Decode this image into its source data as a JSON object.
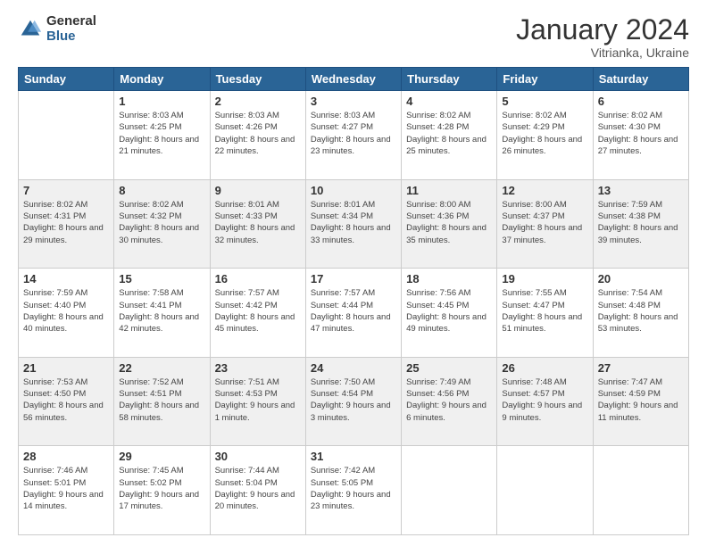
{
  "header": {
    "logo_general": "General",
    "logo_blue": "Blue",
    "title": "January 2024",
    "location": "Vitrianka, Ukraine"
  },
  "weekdays": [
    "Sunday",
    "Monday",
    "Tuesday",
    "Wednesday",
    "Thursday",
    "Friday",
    "Saturday"
  ],
  "weeks": [
    [
      {
        "day": "",
        "sunrise": "",
        "sunset": "",
        "daylight": ""
      },
      {
        "day": "1",
        "sunrise": "Sunrise: 8:03 AM",
        "sunset": "Sunset: 4:25 PM",
        "daylight": "Daylight: 8 hours and 21 minutes."
      },
      {
        "day": "2",
        "sunrise": "Sunrise: 8:03 AM",
        "sunset": "Sunset: 4:26 PM",
        "daylight": "Daylight: 8 hours and 22 minutes."
      },
      {
        "day": "3",
        "sunrise": "Sunrise: 8:03 AM",
        "sunset": "Sunset: 4:27 PM",
        "daylight": "Daylight: 8 hours and 23 minutes."
      },
      {
        "day": "4",
        "sunrise": "Sunrise: 8:02 AM",
        "sunset": "Sunset: 4:28 PM",
        "daylight": "Daylight: 8 hours and 25 minutes."
      },
      {
        "day": "5",
        "sunrise": "Sunrise: 8:02 AM",
        "sunset": "Sunset: 4:29 PM",
        "daylight": "Daylight: 8 hours and 26 minutes."
      },
      {
        "day": "6",
        "sunrise": "Sunrise: 8:02 AM",
        "sunset": "Sunset: 4:30 PM",
        "daylight": "Daylight: 8 hours and 27 minutes."
      }
    ],
    [
      {
        "day": "7",
        "sunrise": "Sunrise: 8:02 AM",
        "sunset": "Sunset: 4:31 PM",
        "daylight": "Daylight: 8 hours and 29 minutes."
      },
      {
        "day": "8",
        "sunrise": "Sunrise: 8:02 AM",
        "sunset": "Sunset: 4:32 PM",
        "daylight": "Daylight: 8 hours and 30 minutes."
      },
      {
        "day": "9",
        "sunrise": "Sunrise: 8:01 AM",
        "sunset": "Sunset: 4:33 PM",
        "daylight": "Daylight: 8 hours and 32 minutes."
      },
      {
        "day": "10",
        "sunrise": "Sunrise: 8:01 AM",
        "sunset": "Sunset: 4:34 PM",
        "daylight": "Daylight: 8 hours and 33 minutes."
      },
      {
        "day": "11",
        "sunrise": "Sunrise: 8:00 AM",
        "sunset": "Sunset: 4:36 PM",
        "daylight": "Daylight: 8 hours and 35 minutes."
      },
      {
        "day": "12",
        "sunrise": "Sunrise: 8:00 AM",
        "sunset": "Sunset: 4:37 PM",
        "daylight": "Daylight: 8 hours and 37 minutes."
      },
      {
        "day": "13",
        "sunrise": "Sunrise: 7:59 AM",
        "sunset": "Sunset: 4:38 PM",
        "daylight": "Daylight: 8 hours and 39 minutes."
      }
    ],
    [
      {
        "day": "14",
        "sunrise": "Sunrise: 7:59 AM",
        "sunset": "Sunset: 4:40 PM",
        "daylight": "Daylight: 8 hours and 40 minutes."
      },
      {
        "day": "15",
        "sunrise": "Sunrise: 7:58 AM",
        "sunset": "Sunset: 4:41 PM",
        "daylight": "Daylight: 8 hours and 42 minutes."
      },
      {
        "day": "16",
        "sunrise": "Sunrise: 7:57 AM",
        "sunset": "Sunset: 4:42 PM",
        "daylight": "Daylight: 8 hours and 45 minutes."
      },
      {
        "day": "17",
        "sunrise": "Sunrise: 7:57 AM",
        "sunset": "Sunset: 4:44 PM",
        "daylight": "Daylight: 8 hours and 47 minutes."
      },
      {
        "day": "18",
        "sunrise": "Sunrise: 7:56 AM",
        "sunset": "Sunset: 4:45 PM",
        "daylight": "Daylight: 8 hours and 49 minutes."
      },
      {
        "day": "19",
        "sunrise": "Sunrise: 7:55 AM",
        "sunset": "Sunset: 4:47 PM",
        "daylight": "Daylight: 8 hours and 51 minutes."
      },
      {
        "day": "20",
        "sunrise": "Sunrise: 7:54 AM",
        "sunset": "Sunset: 4:48 PM",
        "daylight": "Daylight: 8 hours and 53 minutes."
      }
    ],
    [
      {
        "day": "21",
        "sunrise": "Sunrise: 7:53 AM",
        "sunset": "Sunset: 4:50 PM",
        "daylight": "Daylight: 8 hours and 56 minutes."
      },
      {
        "day": "22",
        "sunrise": "Sunrise: 7:52 AM",
        "sunset": "Sunset: 4:51 PM",
        "daylight": "Daylight: 8 hours and 58 minutes."
      },
      {
        "day": "23",
        "sunrise": "Sunrise: 7:51 AM",
        "sunset": "Sunset: 4:53 PM",
        "daylight": "Daylight: 9 hours and 1 minute."
      },
      {
        "day": "24",
        "sunrise": "Sunrise: 7:50 AM",
        "sunset": "Sunset: 4:54 PM",
        "daylight": "Daylight: 9 hours and 3 minutes."
      },
      {
        "day": "25",
        "sunrise": "Sunrise: 7:49 AM",
        "sunset": "Sunset: 4:56 PM",
        "daylight": "Daylight: 9 hours and 6 minutes."
      },
      {
        "day": "26",
        "sunrise": "Sunrise: 7:48 AM",
        "sunset": "Sunset: 4:57 PM",
        "daylight": "Daylight: 9 hours and 9 minutes."
      },
      {
        "day": "27",
        "sunrise": "Sunrise: 7:47 AM",
        "sunset": "Sunset: 4:59 PM",
        "daylight": "Daylight: 9 hours and 11 minutes."
      }
    ],
    [
      {
        "day": "28",
        "sunrise": "Sunrise: 7:46 AM",
        "sunset": "Sunset: 5:01 PM",
        "daylight": "Daylight: 9 hours and 14 minutes."
      },
      {
        "day": "29",
        "sunrise": "Sunrise: 7:45 AM",
        "sunset": "Sunset: 5:02 PM",
        "daylight": "Daylight: 9 hours and 17 minutes."
      },
      {
        "day": "30",
        "sunrise": "Sunrise: 7:44 AM",
        "sunset": "Sunset: 5:04 PM",
        "daylight": "Daylight: 9 hours and 20 minutes."
      },
      {
        "day": "31",
        "sunrise": "Sunrise: 7:42 AM",
        "sunset": "Sunset: 5:05 PM",
        "daylight": "Daylight: 9 hours and 23 minutes."
      },
      {
        "day": "",
        "sunrise": "",
        "sunset": "",
        "daylight": ""
      },
      {
        "day": "",
        "sunrise": "",
        "sunset": "",
        "daylight": ""
      },
      {
        "day": "",
        "sunrise": "",
        "sunset": "",
        "daylight": ""
      }
    ]
  ]
}
